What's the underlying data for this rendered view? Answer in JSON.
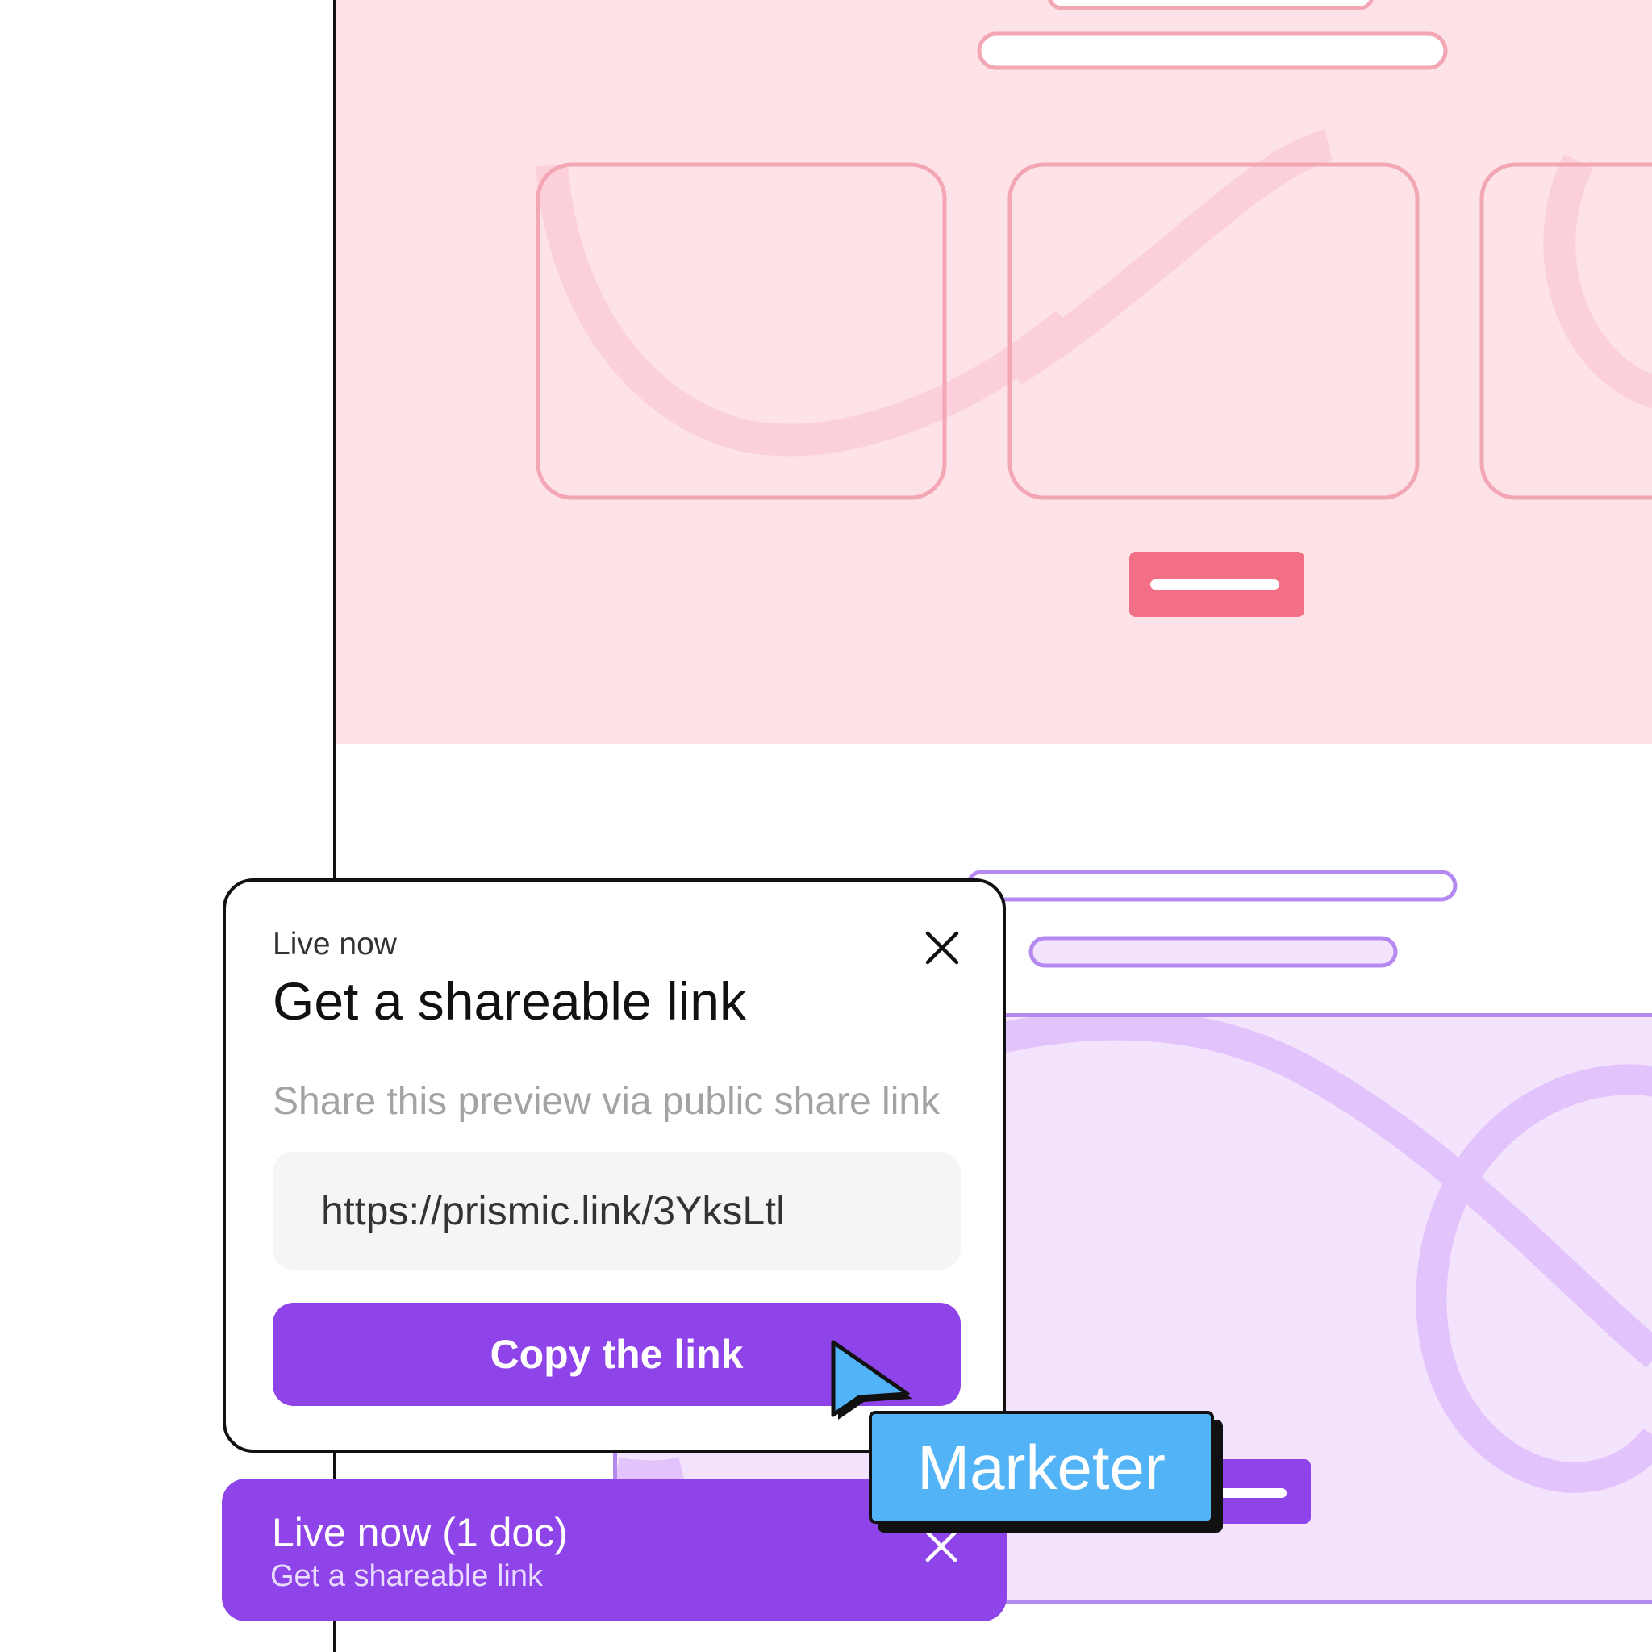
{
  "dialog": {
    "eyebrow": "Live now",
    "title": "Get a shareable link",
    "description": "Share this preview via public share link",
    "link_value": "https://prismic.link/3YksLtl",
    "copy_button_label": "Copy the link",
    "close_icon": "close-icon"
  },
  "toast": {
    "title": "Live now (1 doc)",
    "subtitle": "Get a shareable link",
    "close_icon": "close-icon"
  },
  "cursor_tag": {
    "label": "Marketer",
    "icon": "pointer-cursor-icon"
  },
  "colors": {
    "brand_purple": "#8e44e8",
    "tag_blue": "#52b3f6",
    "pink_bg": "#fde3e8",
    "pink_accent": "#f36f86",
    "lavender_bg": "#f3e3fc"
  }
}
